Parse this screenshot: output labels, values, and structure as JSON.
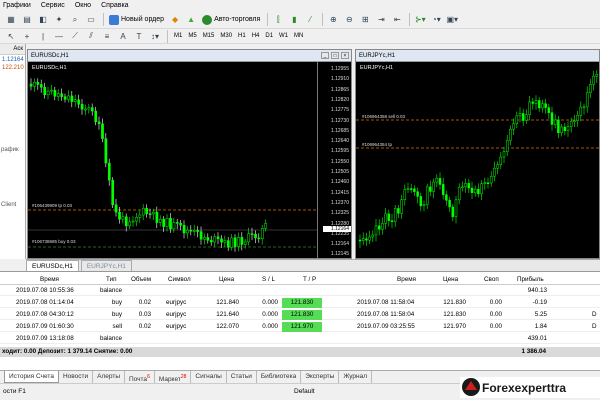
{
  "menu": [
    "Графики",
    "Сервис",
    "Окно",
    "Справка"
  ],
  "toolbar": {
    "new_order": "Новый ордер",
    "autotrade": "Авто-торговля",
    "timeframes": [
      "M1",
      "M5",
      "M15",
      "M30",
      "H1",
      "H4",
      "D1",
      "W1",
      "MN"
    ]
  },
  "left_panel": {
    "header": "Аск",
    "ask_value": "1.12164",
    "second_value": "122.210",
    "label_graphs": "рафик",
    "label_client": "Client"
  },
  "charts": [
    {
      "window_title": "EURUSDc,H1",
      "symbol_label": "EURUSDc,H1",
      "price_ticks": [
        "1.12955",
        "1.12910",
        "1.12865",
        "1.12820",
        "1.12775",
        "1.12730",
        "1.12685",
        "1.12640",
        "1.12595",
        "1.12550",
        "1.12505",
        "1.12460",
        "1.12415",
        "1.12370",
        "1.12325",
        "1.12280",
        "1.12235",
        "1.12164",
        "1.12145"
      ],
      "current_price": "1.12164",
      "order_labels": [
        "#106439909 tp 0.03",
        "#106738685 buy 0.03"
      ]
    },
    {
      "window_title": "EURJPYc,H1",
      "symbol_label": "EURJPYc,H1",
      "order_labels": [
        "#106964358 sell 0.03",
        "#106964354 tp"
      ]
    }
  ],
  "chart_tabs": [
    {
      "label": "EURUSDc,H1",
      "active": true
    },
    {
      "label": "EURJPYc,H1",
      "active": false
    }
  ],
  "table": {
    "columns": [
      "Время",
      "Тип",
      "Объем",
      "Символ",
      "Цена",
      "S / L",
      "T / P",
      "Время",
      "Цена",
      "Своп",
      "Прибыль"
    ],
    "rows": [
      {
        "time": "2019.07.08 10:55:36",
        "type": "balance",
        "volume": "",
        "symbol": "",
        "price": "",
        "sl": "",
        "tp": "",
        "close_time": "",
        "close_price": "",
        "swap": "",
        "profit": "940.13",
        "extra": ""
      },
      {
        "time": "2019.07.08 01:14:04",
        "type": "buy",
        "volume": "0.02",
        "symbol": "eurjpyc",
        "price": "121.840",
        "sl": "0.000",
        "tp": "121.830",
        "close_time": "2019.07.08 11:58:04",
        "close_price": "121.830",
        "swap": "0.00",
        "profit": "-0.19",
        "extra": ""
      },
      {
        "time": "2019.07.08 04:30:12",
        "type": "buy",
        "volume": "0.03",
        "symbol": "eurjpyc",
        "price": "121.640",
        "sl": "0.000",
        "tp": "121.830",
        "close_time": "2019.07.08 11:58:04",
        "close_price": "121.830",
        "swap": "0.00",
        "profit": "5.25",
        "extra": "D"
      },
      {
        "time": "2019.07.09 01:60:30",
        "type": "sell",
        "volume": "0.02",
        "symbol": "eurjpyc",
        "price": "122.070",
        "sl": "0.000",
        "tp": "121.970",
        "close_time": "2019.07.09 03:25:55",
        "close_price": "121.970",
        "swap": "0.00",
        "profit": "1.84",
        "extra": "D"
      },
      {
        "time": "2019.07.09 13:18:08",
        "type": "balance",
        "volume": "",
        "symbol": "",
        "price": "",
        "sl": "",
        "tp": "",
        "close_time": "",
        "close_price": "",
        "swap": "",
        "profit": "439.01",
        "extra": ""
      }
    ],
    "summary": {
      "text": "ходит: 0.00  Депозит: 1 379.14  Снятие: 0.00",
      "profit": "1 386.04"
    }
  },
  "bottom_tabs": [
    {
      "label": "История Счета",
      "badge": "",
      "active": true
    },
    {
      "label": "Новости",
      "badge": "",
      "active": false
    },
    {
      "label": "Алерты",
      "badge": "",
      "active": false
    },
    {
      "label": "Почта",
      "badge": "6",
      "active": false
    },
    {
      "label": "Маркет",
      "badge": "28",
      "active": false
    },
    {
      "label": "Сигналы",
      "badge": "",
      "active": false
    },
    {
      "label": "Статьи",
      "badge": "",
      "active": false
    },
    {
      "label": "Библиотека",
      "badge": "",
      "active": false
    },
    {
      "label": "Эксперты",
      "badge": "",
      "active": false
    },
    {
      "label": "Журнал",
      "badge": "",
      "active": false
    }
  ],
  "status": {
    "help": "ости F1",
    "profile": "Default"
  },
  "logo": {
    "text": "Forexexperttra"
  },
  "colors": {
    "bull_candle": "#00ff00",
    "tp_line": "#d97700",
    "order_line": "#2a8a2a",
    "tp_highlight": "#55dd55",
    "logo_red": "#cc2020"
  }
}
